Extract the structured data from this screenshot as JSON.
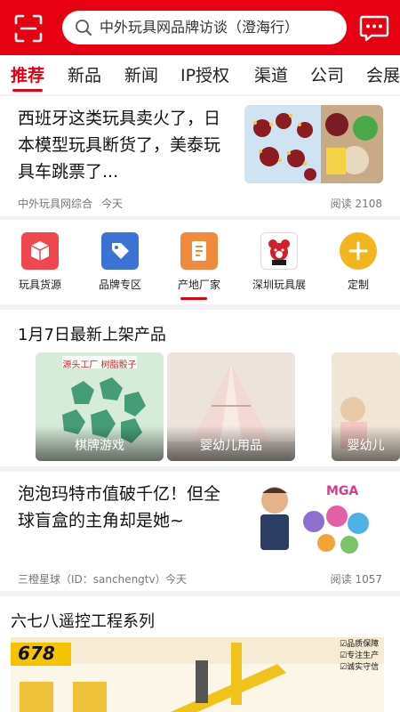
{
  "header": {
    "search_placeholder": "中外玩具网品牌访谈（澄海行）",
    "scan_icon": "scan-icon",
    "message_icon": "message-icon"
  },
  "tabs": [
    {
      "label": "推荐",
      "active": true
    },
    {
      "label": "新品"
    },
    {
      "label": "新闻"
    },
    {
      "label": "IP授权"
    },
    {
      "label": "渠道"
    },
    {
      "label": "公司"
    },
    {
      "label": "会展"
    }
  ],
  "news1": {
    "title": "西班牙这类玩具卖火了，日本模型玩具断货了，美泰玩具车跳票了...",
    "source": "中外玩具网综合",
    "time": "今天",
    "reads": "阅读 2108"
  },
  "categories": [
    {
      "label": "玩具货源",
      "icon": "box-icon",
      "color": "#f0474f"
    },
    {
      "label": "品牌专区",
      "icon": "tag-icon",
      "color": "#3a72d6"
    },
    {
      "label": "产地厂家",
      "icon": "document-icon",
      "color": "#f08a3c",
      "active": true
    },
    {
      "label": "深圳玩具展",
      "icon": "bear-logo-icon",
      "color": "#ffffff"
    },
    {
      "label": "定制",
      "icon": "plus-icon",
      "color": "#f2b51e"
    }
  ],
  "new_products": {
    "title": "1月7日最新上架产品",
    "items": [
      {
        "label": "棋牌游戏",
        "badge": "源头工厂 树脂骰子"
      },
      {
        "label": "婴幼儿用品"
      },
      {
        "label": "婴幼儿"
      }
    ]
  },
  "news2": {
    "title": "泡泡玛特市值破千亿！但全球盲盒的主角却是她~",
    "source": "三橙星球（ID：sanchengtv）",
    "time": "今天",
    "reads": "阅读 1057",
    "logo_text": "MGA"
  },
  "series": {
    "title": "六七八遥控工程系列",
    "brand": "678",
    "badges": [
      "品质保障",
      "专注生产",
      "诚实守信"
    ]
  },
  "colors": {
    "brand_red": "#e60012"
  }
}
